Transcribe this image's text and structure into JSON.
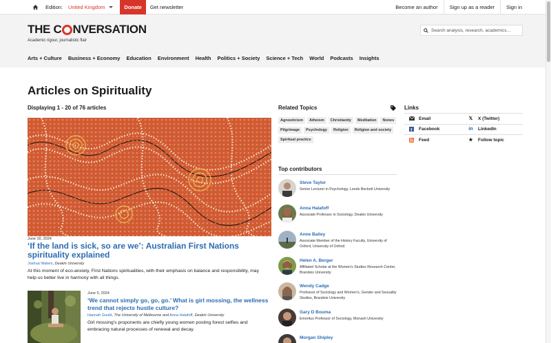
{
  "topbar": {
    "edition_label": "Edition:",
    "edition_value": "United Kingdom",
    "donate": "Donate",
    "newsletter": "Get newsletter",
    "become_author": "Become an author",
    "signup": "Sign up as a reader",
    "signin": "Sign in"
  },
  "header": {
    "logo_left": "THE C",
    "logo_right": "NVERSATION",
    "tagline": "Academic rigour, journalistic flair",
    "search_placeholder": "Search analysis, research, academics…",
    "nav": [
      "Arts + Culture",
      "Business + Economy",
      "Education",
      "Environment",
      "Health",
      "Politics + Society",
      "Science + Tech",
      "World",
      "Podcasts",
      "Insights"
    ]
  },
  "page": {
    "title": "Articles on Spirituality",
    "displaying": "Displaying 1 - 20 of 76 articles"
  },
  "articles": [
    {
      "date": "June 16, 2024",
      "headline": "‘If the land is sick, so are we’: Australian First Nations spirituality explained",
      "author1": "Joshua Waters",
      "inst1": "Deakin University",
      "summary": "At this moment of eco-anxiety, First Nations spiritualities, with their emphasis on balance and responsibility, may help us better live in harmony with all things."
    },
    {
      "date": "June 5, 2024",
      "headline": "‘We cannot simply go, go, go.’ What is girl mossing, the wellness trend that rejects hustle culture?",
      "author1": "Hannah Gould",
      "inst1": "The University of Melbourne",
      "and": "and",
      "author2": "Anna Halafoff",
      "inst2": "Deakin University",
      "summary": "Girl mossing’s proponents are chiefly young women posting forest selfies and embracing natural processes of renewal and decay."
    }
  ],
  "related_topics": {
    "heading": "Related Topics",
    "tags": [
      "Agnosticism",
      "Atheism",
      "Christianity",
      "Meditation",
      "Nones",
      "Pilgrimage",
      "Psychology",
      "Religion",
      "Religion and society",
      "Spiritual practice"
    ]
  },
  "top_contributors": {
    "heading": "Top contributors",
    "people": [
      {
        "name": "Steve Taylor",
        "role": "Senior Lecturer in Psychology, Leeds Beckett University"
      },
      {
        "name": "Anna Halafoff",
        "role": "Associate Professor in Sociology, Deakin University"
      },
      {
        "name": "Anne Bailey",
        "role": "Associate Member of the History Faculty, University of Oxford, University of Oxford"
      },
      {
        "name": "Helen A. Berger",
        "role": "Affiliated Scholar at the Women's Studies Research Center, Brandeis University"
      },
      {
        "name": "Wendy Cadge",
        "role": "Professor of Sociology and Women’s, Gender and Sexuality Studies, Brandeis University"
      },
      {
        "name": "Gary D Bouma",
        "role": "Emeritus Professor of Sociology, Monash University"
      },
      {
        "name": "Morgan Shipley",
        "role": ""
      }
    ]
  },
  "links": {
    "heading": "Links",
    "items": [
      {
        "icon": "email-icon",
        "label": "Email"
      },
      {
        "icon": "x-twitter-icon",
        "label": "X (Twitter)"
      },
      {
        "icon": "facebook-icon",
        "label": "Facebook"
      },
      {
        "icon": "linkedin-icon",
        "label": "LinkedIn"
      },
      {
        "icon": "rss-feed-icon",
        "label": "Feed"
      },
      {
        "icon": "star-icon",
        "label": "Follow topic"
      }
    ]
  },
  "colors": {
    "brand_red": "#d8352a",
    "link_blue": "#2c6cb0",
    "header_bg": "#f3f3f3"
  }
}
